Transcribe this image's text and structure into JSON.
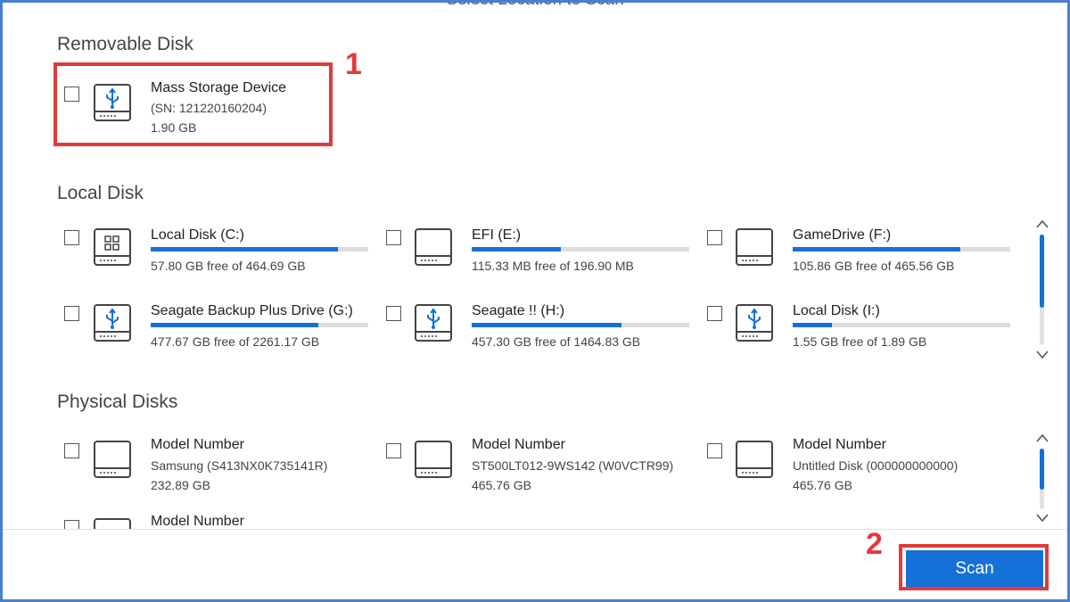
{
  "header": {
    "title": "Select Location to Scan"
  },
  "removable": {
    "title": "Removable Disk",
    "items": [
      {
        "name": "Mass Storage Device",
        "serial": "(SN: 121220160204)",
        "size": "1.90 GB",
        "icon": "usb-drive-icon"
      }
    ]
  },
  "local": {
    "title": "Local Disk",
    "items": [
      {
        "name": "Local Disk (C:)",
        "free": "57.80 GB free of 464.69 GB",
        "used_fraction": 0.86,
        "icon": "windows-drive-icon"
      },
      {
        "name": "EFI (E:)",
        "free": "115.33 MB free of 196.90 MB",
        "used_fraction": 0.41,
        "icon": "hard-drive-icon"
      },
      {
        "name": "GameDrive (F:)",
        "free": "105.86 GB free of 465.56 GB",
        "used_fraction": 0.77,
        "icon": "hard-drive-icon"
      },
      {
        "name": "Seagate Backup Plus Drive (G:)",
        "free": "477.67 GB free of 2261.17 GB",
        "used_fraction": 0.77,
        "icon": "usb-drive-icon"
      },
      {
        "name": "Seagate !! (H:)",
        "free": "457.30 GB free of 1464.83 GB",
        "used_fraction": 0.69,
        "icon": "usb-drive-icon"
      },
      {
        "name": "Local Disk (I:)",
        "free": "1.55 GB free of 1.89 GB",
        "used_fraction": 0.18,
        "icon": "usb-drive-icon"
      }
    ]
  },
  "physical": {
    "title": "Physical Disks",
    "items": [
      {
        "name": "Model Number",
        "model": "Samsung (S413NX0K735141R)",
        "size": "232.89 GB",
        "icon": "hard-drive-icon"
      },
      {
        "name": "Model Number",
        "model": "ST500LT012-9WS142 (W0VCTR99)",
        "size": "465.76 GB",
        "icon": "hard-drive-icon"
      },
      {
        "name": "Model Number",
        "model": "Untitled Disk (000000000000)",
        "size": "465.76 GB",
        "icon": "hard-drive-icon"
      },
      {
        "name": "Model Number",
        "icon": "hard-drive-icon"
      }
    ]
  },
  "annotations": {
    "step1": "1",
    "step2": "2",
    "color": "#e23a3a"
  },
  "footer": {
    "scan_label": "Scan"
  },
  "colors": {
    "accent": "#1570d8",
    "frame": "#4a7fd0"
  }
}
